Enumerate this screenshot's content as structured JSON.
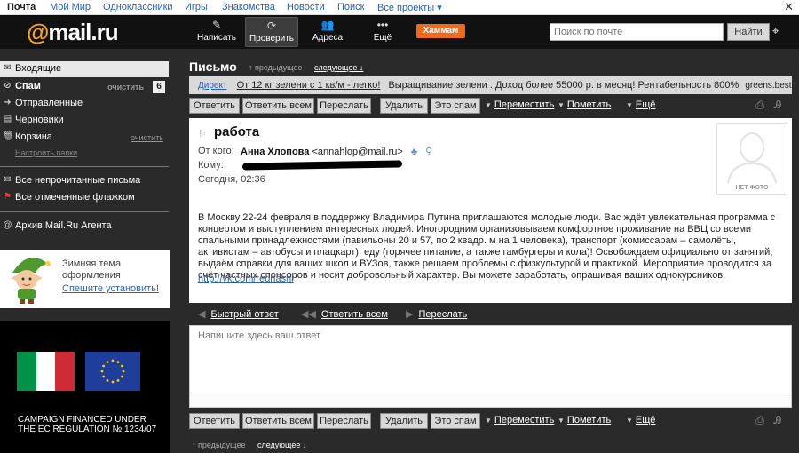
{
  "topnav": {
    "items": [
      "Почта",
      "Мой Мир",
      "Одноклассники",
      "Игры",
      "Знакомства",
      "Новости",
      "Поиск",
      "Все проекты ▾"
    ],
    "close": "✕"
  },
  "header": {
    "logo_at": "@",
    "logo_text": "mail.ru",
    "buttons": [
      {
        "icon": "✎",
        "label": "Написать"
      },
      {
        "icon": "⟳",
        "label": "Проверить"
      },
      {
        "icon": "👥",
        "label": "Адреса"
      },
      {
        "icon": "•••",
        "label": "Ещё"
      }
    ],
    "hammam": "Хаммам",
    "search_placeholder": "Поиск по почте",
    "search_button": "Найти",
    "search_extra": "⌖"
  },
  "sidebar": {
    "folders": [
      {
        "icon": "✉",
        "label": "Входящие"
      },
      {
        "icon": "⊘",
        "label": "Спам",
        "sub": "очистить",
        "count": "6"
      },
      {
        "icon": "➜",
        "label": "Отправленные"
      },
      {
        "icon": "▤",
        "label": "Черновики"
      },
      {
        "icon": "🗑",
        "label": "Корзина",
        "sub": "очистить"
      }
    ],
    "settings_link": "Настроить папки",
    "filters": [
      {
        "icon": "✉",
        "label": "Все непрочитанные письма"
      },
      {
        "icon": "⚑",
        "label": "Все отмеченные флажком"
      }
    ],
    "archive": {
      "icon": "@",
      "label": "Архив Mail.Ru Агента"
    },
    "theme": {
      "title": "Зимняя тема оформления",
      "link": "Спешите установить!"
    },
    "ad_text": "CAMPAIGN FINANCED UNDER THE EC REGULATION № 1234/07",
    "colors": {
      "it_green": "#009246",
      "it_white": "#ffffff",
      "it_red": "#ce2b37",
      "eu_blue": "#1f3e9c",
      "eu_star": "#ffcc00"
    }
  },
  "main": {
    "title": "Письмо",
    "prev": "↑ предыдущее",
    "next": "следующее ↓",
    "ad": {
      "tag": "Директ",
      "head": "От 12 кг зелени с 1 кв/м - легко!",
      "text": "Выращивание зелени . Доход более 55000 р. в месяц! Рентабельность 800%",
      "domain": "greens.best-business.ru"
    },
    "toolbar": {
      "reply": "Ответить",
      "reply_all": "Ответить всем",
      "forward": "Переслать",
      "delete": "Удалить",
      "spam": "Это спам",
      "move": "Переместить",
      "mark": "Пометить",
      "more": "Ещё"
    },
    "letter": {
      "subject": "работа",
      "from_label": "От кого:",
      "from_name": "Анна Хлопова",
      "from_email": "<annahlop@mail.ru>",
      "to_label": "Кому:",
      "date": "Сегодня, 02:36",
      "no_photo": "НЕТ ФОТО",
      "body": "В Москву 22-24 февраля в поддержку Владимира Путина приглашаются молодые люди. Вас ждёт увлекательная программа с концертом и выступлением интересных людей. Иногородним организовываем комфортное проживание на ВВЦ со всеми спальными принадлежностями (павильоны 20 и 57, по 2 квадр. м на 1 человека), транспорт (комиссарам – самолёты, активистам – автобусы и плацкарт), еду (горячее питание, а также гамбургеры и кола)! Освобождаем официально от занятий, выдаём справки для ваших школ и ВУЗов, также решаем проблемы с физкультурой и практикой. Мероприятие проводится за счёт частных спонсоров и носит добровольный характер. Вы можете заработать, опрашивая ваших однокурсников.",
      "link": "http://vk.com/rednashi"
    },
    "quick": {
      "reply": "Быстрый ответ",
      "reply_all": "Ответить всем",
      "forward": "Переслать"
    },
    "reply_placeholder": "Напишите здесь ваш ответ"
  }
}
